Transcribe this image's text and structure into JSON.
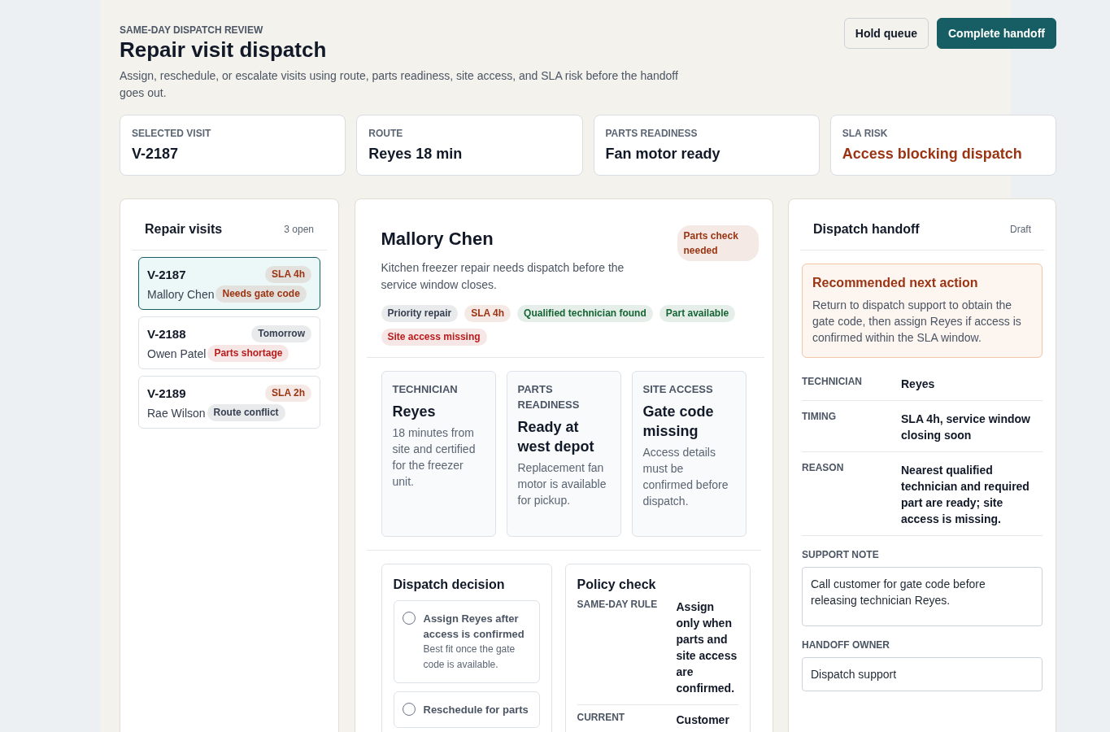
{
  "header": {
    "eyebrow": "SAME-DAY DISPATCH REVIEW",
    "title": "Repair visit dispatch",
    "description": "Assign, reschedule, or escalate visits using route, parts readiness, site access, and SLA risk before the handoff goes out."
  },
  "actions": [
    {
      "label": "Hold queue",
      "kind": "secondary"
    },
    {
      "label": "Complete handoff",
      "kind": "primary"
    }
  ],
  "stats": [
    {
      "label": "SELECTED VISIT",
      "value": "V-2187",
      "color": "#111827"
    },
    {
      "label": "ROUTE",
      "value": "Reyes 18 min",
      "color": "#111827"
    },
    {
      "label": "PARTS READINESS",
      "value": "Fan motor ready",
      "color": "#111827"
    },
    {
      "label": "SLA RISK",
      "value": "Access blocking dispatch",
      "color": "#9a3412"
    }
  ],
  "visits": {
    "title": "Repair visits",
    "count": "3 open",
    "items": [
      {
        "id": "V-2187",
        "name": "Mallory Chen",
        "badge": {
          "label": "SLA 4h",
          "color": "#9a3412"
        },
        "tag": {
          "label": "Needs gate code",
          "color": "#9a3412"
        },
        "selected": true
      },
      {
        "id": "V-2188",
        "name": "Owen Patel",
        "badge": {
          "label": "Tomorrow",
          "color": "#374151"
        },
        "tag": {
          "label": "Parts shortage",
          "color": "#b91c1c"
        },
        "selected": false
      },
      {
        "id": "V-2189",
        "name": "Rae Wilson",
        "badge": {
          "label": "SLA 2h",
          "color": "#9a3412"
        },
        "tag": {
          "label": "Route conflict",
          "color": "#374151"
        },
        "selected": false
      }
    ]
  },
  "detail": {
    "name": "Mallory Chen",
    "status": {
      "label": "Parts check needed",
      "color": "#9a3412"
    },
    "summary": "Kitchen freezer repair needs dispatch before the service window closes.",
    "tags": [
      {
        "label": "Priority repair",
        "color": "#374151"
      },
      {
        "label": "SLA 4h",
        "color": "#9a3412"
      },
      {
        "label": "Qualified technician found",
        "color": "#166534"
      },
      {
        "label": "Part available",
        "color": "#166534"
      },
      {
        "label": "Site access missing",
        "color": "#b91c1c"
      }
    ],
    "facts": [
      {
        "label": "TECHNICIAN",
        "value": "Reyes",
        "note": "18 minutes from site and certified for the freezer unit."
      },
      {
        "label": "PARTS READINESS",
        "value": "Ready at west depot",
        "note": "Replacement fan motor is available for pickup."
      },
      {
        "label": "SITE ACCESS",
        "value": "Gate code missing",
        "note": "Access details must be confirmed before dispatch."
      }
    ],
    "decision": {
      "title": "Dispatch decision",
      "options": [
        {
          "label": "Assign Reyes after access is confirmed",
          "note": "Best fit once the gate code is available.",
          "selected": false
        },
        {
          "label": "Reschedule for parts",
          "selected": false
        }
      ]
    },
    "policy": {
      "title": "Policy check",
      "rows": [
        {
          "label": "SAME-DAY RULE",
          "value": "Assign only when parts and site access are confirmed."
        },
        {
          "label": "CURRENT",
          "value": "Customer"
        }
      ]
    }
  },
  "handoff": {
    "title": "Dispatch handoff",
    "status": "Draft",
    "recommendation": {
      "title": "Recommended next action",
      "text": "Return to dispatch support to obtain the gate code, then assign Reyes if access is confirmed within the SLA window."
    },
    "rows": [
      {
        "label": "TECHNICIAN",
        "value": "Reyes"
      },
      {
        "label": "TIMING",
        "value": "SLA 4h, service window closing soon"
      },
      {
        "label": "REASON",
        "value": "Nearest qualified technician and required part are ready; site access is missing."
      }
    ],
    "fields": [
      {
        "label": "SUPPORT NOTE",
        "value": "Call customer for gate code before releasing technician Reyes.",
        "kind": "textarea"
      },
      {
        "label": "HANDOFF OWNER",
        "value": "Dispatch support",
        "kind": "input"
      }
    ]
  }
}
